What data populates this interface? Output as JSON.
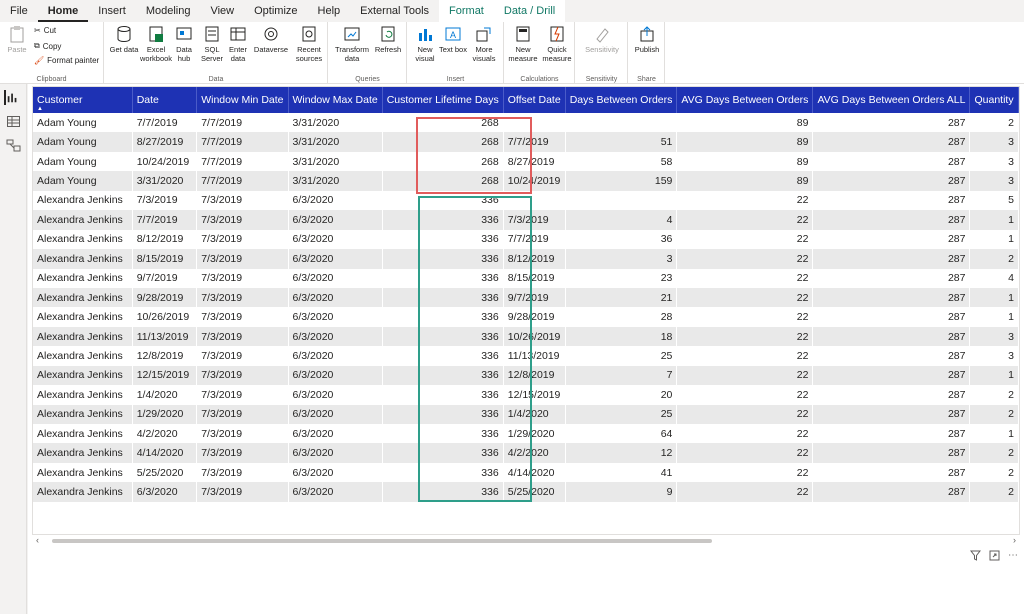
{
  "menu": {
    "tabs": [
      "File",
      "Home",
      "Insert",
      "Modeling",
      "View",
      "Optimize",
      "Help",
      "External Tools",
      "Format",
      "Data / Drill"
    ]
  },
  "ribbon": {
    "clipboard": {
      "paste": "Paste",
      "cut": "Cut",
      "copy": "Copy",
      "format_painter": "Format painter",
      "label": "Clipboard"
    },
    "data": {
      "get_data": "Get data",
      "excel": "Excel workbook",
      "hub": "Data hub",
      "sql": "SQL Server",
      "enter": "Enter data",
      "dataverse": "Dataverse",
      "recent": "Recent sources",
      "label": "Data"
    },
    "queries": {
      "transform": "Transform data",
      "refresh": "Refresh",
      "label": "Queries"
    },
    "insert": {
      "visual": "New visual",
      "textbox": "Text box",
      "more": "More visuals",
      "label": "Insert"
    },
    "calculations": {
      "measure": "New measure",
      "quick": "Quick measure",
      "label": "Calculations"
    },
    "sensitivity": {
      "btn": "Sensitivity",
      "label": "Sensitivity"
    },
    "share": {
      "publish": "Publish",
      "label": "Share"
    }
  },
  "table": {
    "columns": [
      "Customer",
      "Date",
      "Window Min Date",
      "Window Max Date",
      "Customer Lifetime Days",
      "Offset Date",
      "Days Between Orders",
      "AVG Days Between Orders",
      "AVG Days Between Orders ALL",
      "Quantity"
    ],
    "rows": [
      [
        "Adam Young",
        "7/7/2019",
        "7/7/2019",
        "3/31/2020",
        "268",
        "",
        "",
        "89",
        "287",
        "2"
      ],
      [
        "Adam Young",
        "8/27/2019",
        "7/7/2019",
        "3/31/2020",
        "268",
        "7/7/2019",
        "51",
        "89",
        "287",
        "3"
      ],
      [
        "Adam Young",
        "10/24/2019",
        "7/7/2019",
        "3/31/2020",
        "268",
        "8/27/2019",
        "58",
        "89",
        "287",
        "3"
      ],
      [
        "Adam Young",
        "3/31/2020",
        "7/7/2019",
        "3/31/2020",
        "268",
        "10/24/2019",
        "159",
        "89",
        "287",
        "3"
      ],
      [
        "Alexandra Jenkins",
        "7/3/2019",
        "7/3/2019",
        "6/3/2020",
        "336",
        "",
        "",
        "22",
        "287",
        "5"
      ],
      [
        "Alexandra Jenkins",
        "7/7/2019",
        "7/3/2019",
        "6/3/2020",
        "336",
        "7/3/2019",
        "4",
        "22",
        "287",
        "1"
      ],
      [
        "Alexandra Jenkins",
        "8/12/2019",
        "7/3/2019",
        "6/3/2020",
        "336",
        "7/7/2019",
        "36",
        "22",
        "287",
        "1"
      ],
      [
        "Alexandra Jenkins",
        "8/15/2019",
        "7/3/2019",
        "6/3/2020",
        "336",
        "8/12/2019",
        "3",
        "22",
        "287",
        "2"
      ],
      [
        "Alexandra Jenkins",
        "9/7/2019",
        "7/3/2019",
        "6/3/2020",
        "336",
        "8/15/2019",
        "23",
        "22",
        "287",
        "4"
      ],
      [
        "Alexandra Jenkins",
        "9/28/2019",
        "7/3/2019",
        "6/3/2020",
        "336",
        "9/7/2019",
        "21",
        "22",
        "287",
        "1"
      ],
      [
        "Alexandra Jenkins",
        "10/26/2019",
        "7/3/2019",
        "6/3/2020",
        "336",
        "9/28/2019",
        "28",
        "22",
        "287",
        "1"
      ],
      [
        "Alexandra Jenkins",
        "11/13/2019",
        "7/3/2019",
        "6/3/2020",
        "336",
        "10/26/2019",
        "18",
        "22",
        "287",
        "3"
      ],
      [
        "Alexandra Jenkins",
        "12/8/2019",
        "7/3/2019",
        "6/3/2020",
        "336",
        "11/13/2019",
        "25",
        "22",
        "287",
        "3"
      ],
      [
        "Alexandra Jenkins",
        "12/15/2019",
        "7/3/2019",
        "6/3/2020",
        "336",
        "12/8/2019",
        "7",
        "22",
        "287",
        "1"
      ],
      [
        "Alexandra Jenkins",
        "1/4/2020",
        "7/3/2019",
        "6/3/2020",
        "336",
        "12/15/2019",
        "20",
        "22",
        "287",
        "2"
      ],
      [
        "Alexandra Jenkins",
        "1/29/2020",
        "7/3/2019",
        "6/3/2020",
        "336",
        "1/4/2020",
        "25",
        "22",
        "287",
        "2"
      ],
      [
        "Alexandra Jenkins",
        "4/2/2020",
        "7/3/2019",
        "6/3/2020",
        "336",
        "1/29/2020",
        "64",
        "22",
        "287",
        "1"
      ],
      [
        "Alexandra Jenkins",
        "4/14/2020",
        "7/3/2019",
        "6/3/2020",
        "336",
        "4/2/2020",
        "12",
        "22",
        "287",
        "2"
      ],
      [
        "Alexandra Jenkins",
        "5/25/2020",
        "7/3/2019",
        "6/3/2020",
        "336",
        "4/14/2020",
        "41",
        "22",
        "287",
        "2"
      ],
      [
        "Alexandra Jenkins",
        "6/3/2020",
        "7/3/2019",
        "6/3/2020",
        "336",
        "5/25/2020",
        "9",
        "22",
        "287",
        "2"
      ]
    ]
  },
  "colors": {
    "header": "#1e32b4",
    "highlight_red": "#e15c5c",
    "highlight_green": "#2e9e8a"
  },
  "icons": [
    "filter-icon",
    "focus-mode-icon",
    "more-options-icon"
  ]
}
